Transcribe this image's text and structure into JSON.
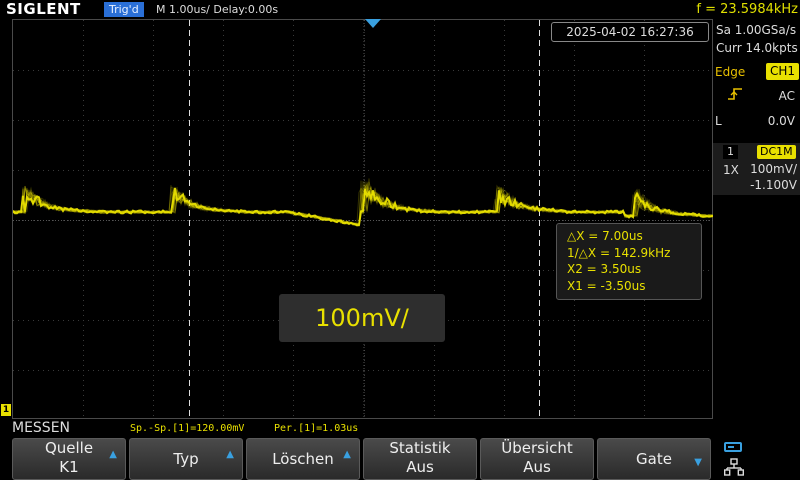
{
  "header": {
    "brand": "SIGLENT",
    "trigger_status": "Trig'd",
    "timebase": "M 1.00us/  Delay:0.00s",
    "frequency": "f = 23.5984kHz"
  },
  "screen": {
    "datetime": "2025-04-02 16:27:36",
    "channel_marker": "1",
    "scale_popup": "100mV/",
    "cursor_readout": {
      "delta_x": "△X = 7.00us",
      "inv_delta_x": "1/△X = 142.9kHz",
      "x2": "X2 = 3.50us",
      "x1": "X1 = -3.50us"
    },
    "trace_color": "#e8e000"
  },
  "side_panel": {
    "sample_rate": "Sa 1.00GSa/s",
    "memory_depth": "Curr 14.0kpts",
    "trigger_type": "Edge",
    "trigger_source": "CH1",
    "trigger_slope_icon": "rising-edge-icon",
    "trigger_coupling": "AC",
    "level_label": "L",
    "level_value": "0.0V",
    "channel": {
      "number": "1",
      "coupling": "DC1M",
      "probe": "1X",
      "volts_per_div": "100mV/",
      "offset": "-1.100V"
    }
  },
  "measure": {
    "title": "MESSEN",
    "values": [
      "Sp.-Sp.[1]=120.00mV",
      "Per.[1]=1.03us"
    ]
  },
  "softkeys": [
    {
      "line1": "Quelle",
      "line2": "K1",
      "arrow": "up"
    },
    {
      "line1": "Typ",
      "line2": "",
      "arrow": "up"
    },
    {
      "line1": "Löschen",
      "line2": "",
      "arrow": "up"
    },
    {
      "line1": "Statistik",
      "line2": "Aus",
      "arrow": ""
    },
    {
      "line1": "Übersicht",
      "line2": "Aus",
      "arrow": ""
    },
    {
      "line1": "Gate",
      "line2": "",
      "arrow": "down"
    }
  ],
  "status_icons": [
    "usb-icon",
    "network-icon"
  ]
}
